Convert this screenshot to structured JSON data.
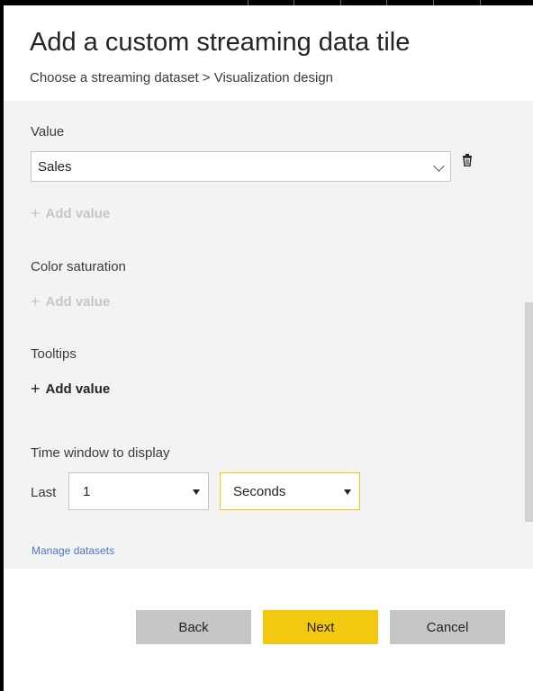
{
  "dialog": {
    "title": "Add a custom streaming data tile",
    "breadcrumb": "Choose a streaming dataset > Visualization design"
  },
  "value_section": {
    "label": "Value",
    "selected": "Sales",
    "add_value_label": "Add value"
  },
  "color_saturation": {
    "label": "Color saturation",
    "add_value_label": "Add value"
  },
  "tooltips": {
    "label": "Tooltips",
    "add_value_label": "Add value"
  },
  "time_window": {
    "label": "Time window to display",
    "last_label": "Last",
    "amount": "1",
    "unit": "Seconds"
  },
  "manage_link": "Manage datasets",
  "footer": {
    "back_label": "Back",
    "next_label": "Next",
    "cancel_label": "Cancel"
  },
  "colors": {
    "accent": "#f2c811",
    "link": "#4a78c2",
    "content_bg": "#f3f3f3",
    "button_gray": "#c8c6c4"
  },
  "icons": {
    "trash": "trash-icon",
    "plus": "plus-icon",
    "dropdown": "chevron-down-icon"
  }
}
